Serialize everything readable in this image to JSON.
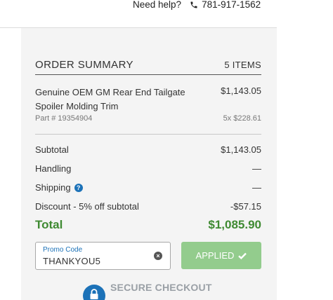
{
  "header": {
    "help_text": "Need help?",
    "phone": "781-917-1562",
    "phone_icon": "phone-icon"
  },
  "summary": {
    "title": "ORDER SUMMARY",
    "item_count": "5 ITEMS",
    "item": {
      "name_line1": "Genuine OEM GM Rear End Tailgate",
      "name_line2": "Spoiler Molding Trim",
      "price": "$1,143.05",
      "part_number": "Part # 19354904",
      "qty_price": "5x $228.61"
    },
    "rows": [
      {
        "label": "Subtotal",
        "value": "$1,143.05"
      },
      {
        "label": "Handling",
        "value": "—"
      },
      {
        "label": "Shipping",
        "value": "—",
        "icon": "question-icon"
      },
      {
        "label": "Discount - 5% off subtotal",
        "value": "-$57.15"
      }
    ],
    "total_label": "Total",
    "total_value": "$1,085.90"
  },
  "promo": {
    "label": "Promo Code",
    "value": "THANKYOU5",
    "clear_icon": "clear-icon"
  },
  "applied_button": {
    "label": "APPLIED",
    "icon": "check-icon"
  },
  "secure": {
    "text": "SECURE CHECKOUT",
    "icon": "lock-icon"
  },
  "colors": {
    "accent_blue": "#1c72b8",
    "total_green": "#3f8a32",
    "applied_green": "#93cc8d",
    "panel_bg": "#f4f4f4"
  }
}
